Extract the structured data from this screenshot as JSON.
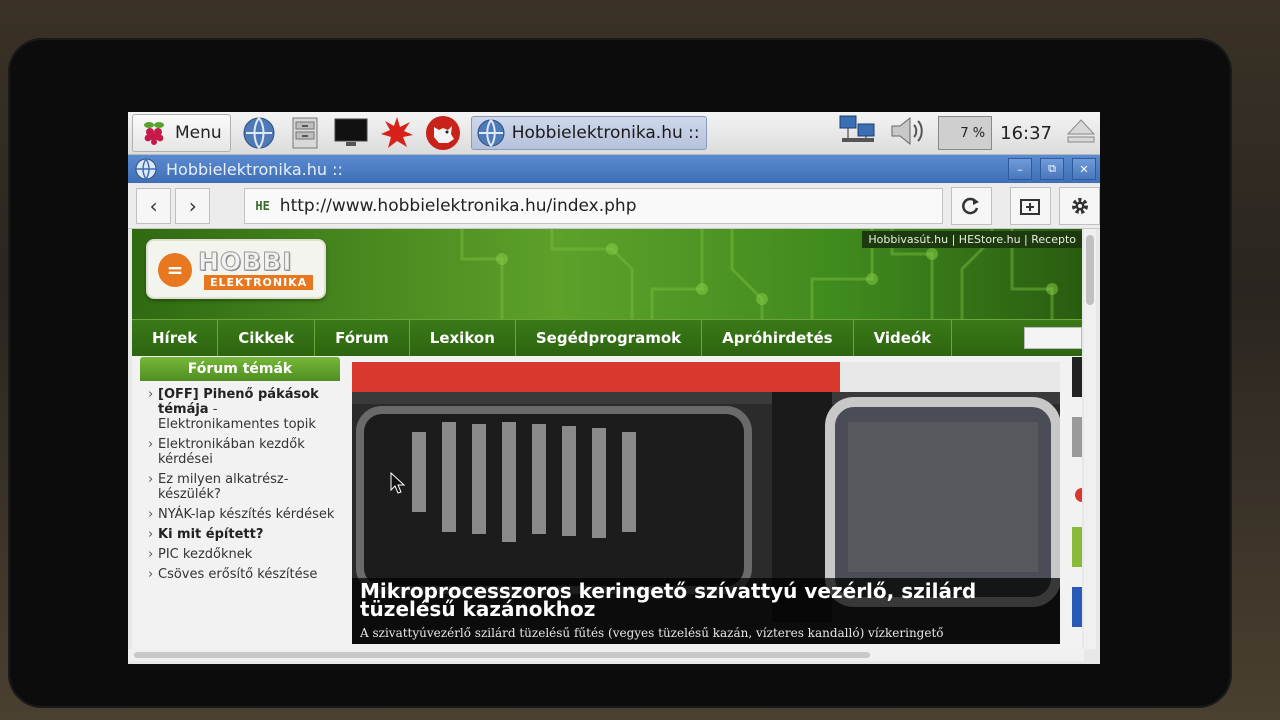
{
  "taskbar": {
    "menu_label": "Menu",
    "launchers": [
      "globe-icon",
      "file-manager-icon",
      "terminal-icon",
      "burst-icon",
      "wolf-icon"
    ],
    "task_button_label": "Hobbielektronika.hu ::",
    "cpu_usage": "7 %",
    "clock": "16:37"
  },
  "window": {
    "title": "Hobbielektronika.hu ::",
    "controls": [
      "minimize",
      "restore",
      "close"
    ]
  },
  "browser": {
    "url_badge": "HE",
    "url": "http://www.hobbielektronika.hu/index.php"
  },
  "site": {
    "logo_top": "HOBBI",
    "logo_bottom": "ELEKTRONIKA",
    "top_links": "Hobbivasút.hu | HEStore.hu | Recepto",
    "nav": [
      "Hírek",
      "Cikkek",
      "Fórum",
      "Lexikon",
      "Segédprogramok",
      "Apróhirdetés",
      "Videók"
    ],
    "sidebar": {
      "heading": "Fórum témák",
      "items": [
        {
          "bold": "[OFF] Pihenő pákások témája",
          "rest": " - Elektronikamentes topik"
        },
        {
          "bold": "",
          "rest": "Elektronikában kezdők kérdései"
        },
        {
          "bold": "",
          "rest": "Ez milyen alkatrész-készülék?"
        },
        {
          "bold": "",
          "rest": "NYÁK-lap készítés kérdések"
        },
        {
          "bold": "Ki mit épített?",
          "rest": ""
        },
        {
          "bold": "",
          "rest": "PIC kezdőknek"
        },
        {
          "bold": "",
          "rest": "Csöves erősítő készítése"
        }
      ]
    },
    "feature": {
      "title": "Mikroprocesszoros keringető szívattyú vezérlő, szilárd tüzelésű kazánokhoz",
      "subtitle": "A szivattyúvezérlő szilárd tüzelésű fűtés (vegyes tüzelésű kazán, vízteres kandalló) vízkeringető"
    }
  },
  "colors": {
    "banner_green": "#5da12a",
    "nav_green": "#2d6410",
    "accent_orange": "#e87820",
    "titlebar_blue": "#4a7cc0"
  }
}
